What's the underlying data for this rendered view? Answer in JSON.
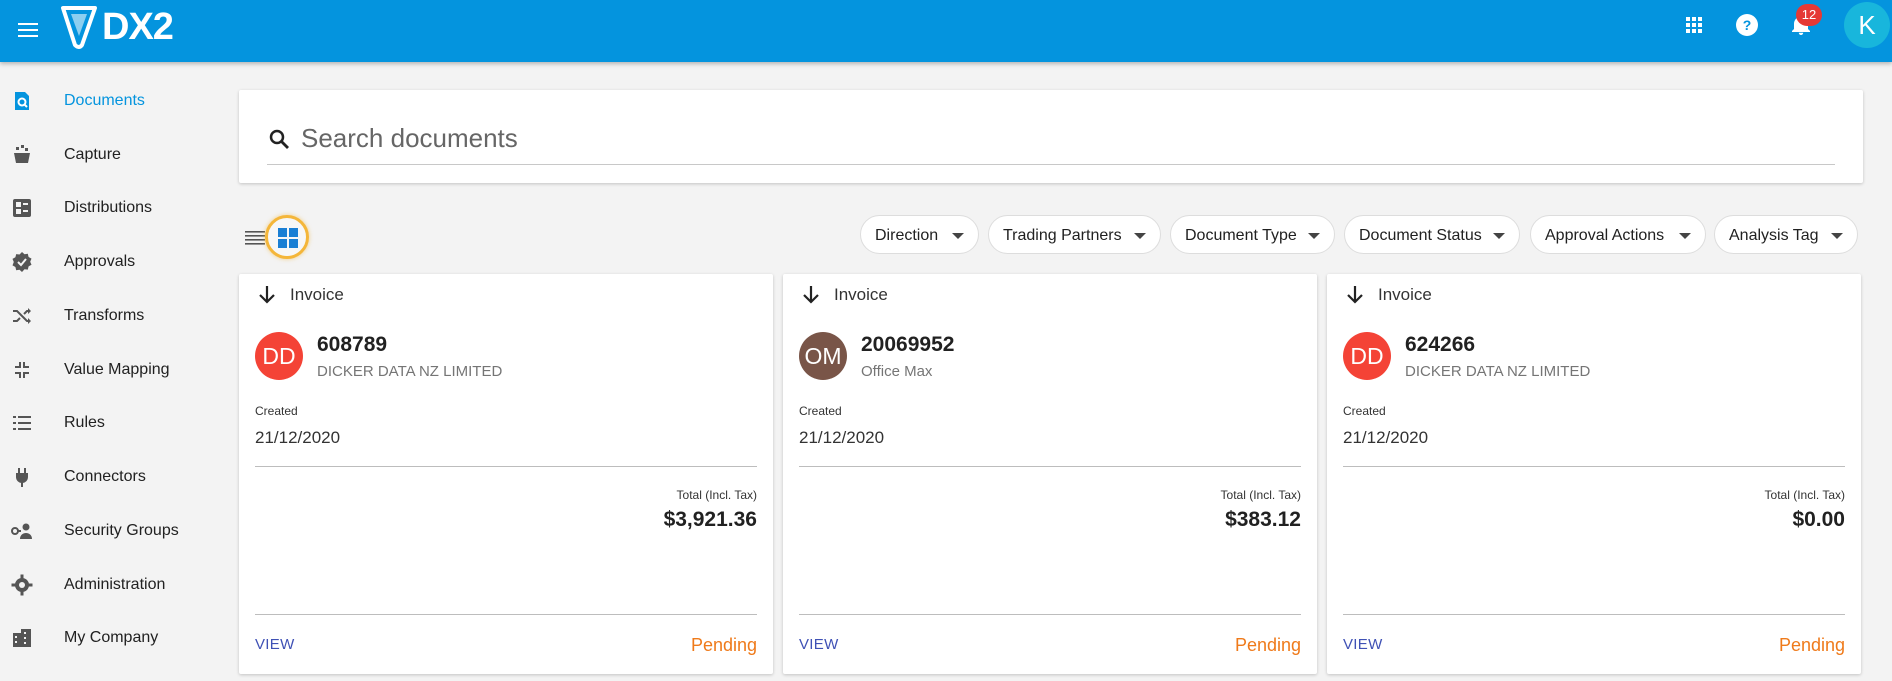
{
  "app": {
    "name": "DX2",
    "brand_color": "#0494de",
    "notifications_count": "12",
    "user_initial": "K"
  },
  "icons": {
    "menu": "hamburger-icon",
    "apps": "apps-grid-icon",
    "help": "help-icon",
    "notifications": "bell-icon"
  },
  "sidebar": {
    "items": [
      {
        "label": "Documents",
        "icon": "document-search-icon",
        "active": true
      },
      {
        "label": "Capture",
        "icon": "capture-icon"
      },
      {
        "label": "Distributions",
        "icon": "distributions-icon"
      },
      {
        "label": "Approvals",
        "icon": "approval-badge-icon"
      },
      {
        "label": "Transforms",
        "icon": "shuffle-icon"
      },
      {
        "label": "Value Mapping",
        "icon": "value-mapping-icon"
      },
      {
        "label": "Rules",
        "icon": "list-icon"
      },
      {
        "label": "Connectors",
        "icon": "plug-icon"
      },
      {
        "label": "Security Groups",
        "icon": "security-groups-icon"
      },
      {
        "label": "Administration",
        "icon": "gear-icon"
      },
      {
        "label": "My Company",
        "icon": "building-icon"
      }
    ]
  },
  "search": {
    "placeholder": "Search documents"
  },
  "view": {
    "mode": "grid"
  },
  "filters": [
    {
      "label": "Direction"
    },
    {
      "label": "Trading Partners"
    },
    {
      "label": "Document Type"
    },
    {
      "label": "Document Status"
    },
    {
      "label": "Approval Actions"
    },
    {
      "label": "Analysis Tag"
    }
  ],
  "cards": [
    {
      "doc_type": "Invoice",
      "direction": "inbound",
      "avatar_initials": "DD",
      "avatar_color": "#f44336",
      "number": "608789",
      "partner": "DICKER DATA NZ LIMITED",
      "created_label": "Created",
      "created_date": "21/12/2020",
      "total_label": "Total (Incl. Tax)",
      "total": "$3,921.36",
      "view_label": "VIEW",
      "status": "Pending"
    },
    {
      "doc_type": "Invoice",
      "direction": "inbound",
      "avatar_initials": "OM",
      "avatar_color": "#795548",
      "number": "20069952",
      "partner": "Office Max",
      "created_label": "Created",
      "created_date": "21/12/2020",
      "total_label": "Total (Incl. Tax)",
      "total": "$383.12",
      "view_label": "VIEW",
      "status": "Pending"
    },
    {
      "doc_type": "Invoice",
      "direction": "inbound",
      "avatar_initials": "DD",
      "avatar_color": "#f44336",
      "number": "624266",
      "partner": "DICKER DATA NZ LIMITED",
      "created_label": "Created",
      "created_date": "21/12/2020",
      "total_label": "Total (Incl. Tax)",
      "total": "$0.00",
      "view_label": "VIEW",
      "status": "Pending"
    }
  ]
}
